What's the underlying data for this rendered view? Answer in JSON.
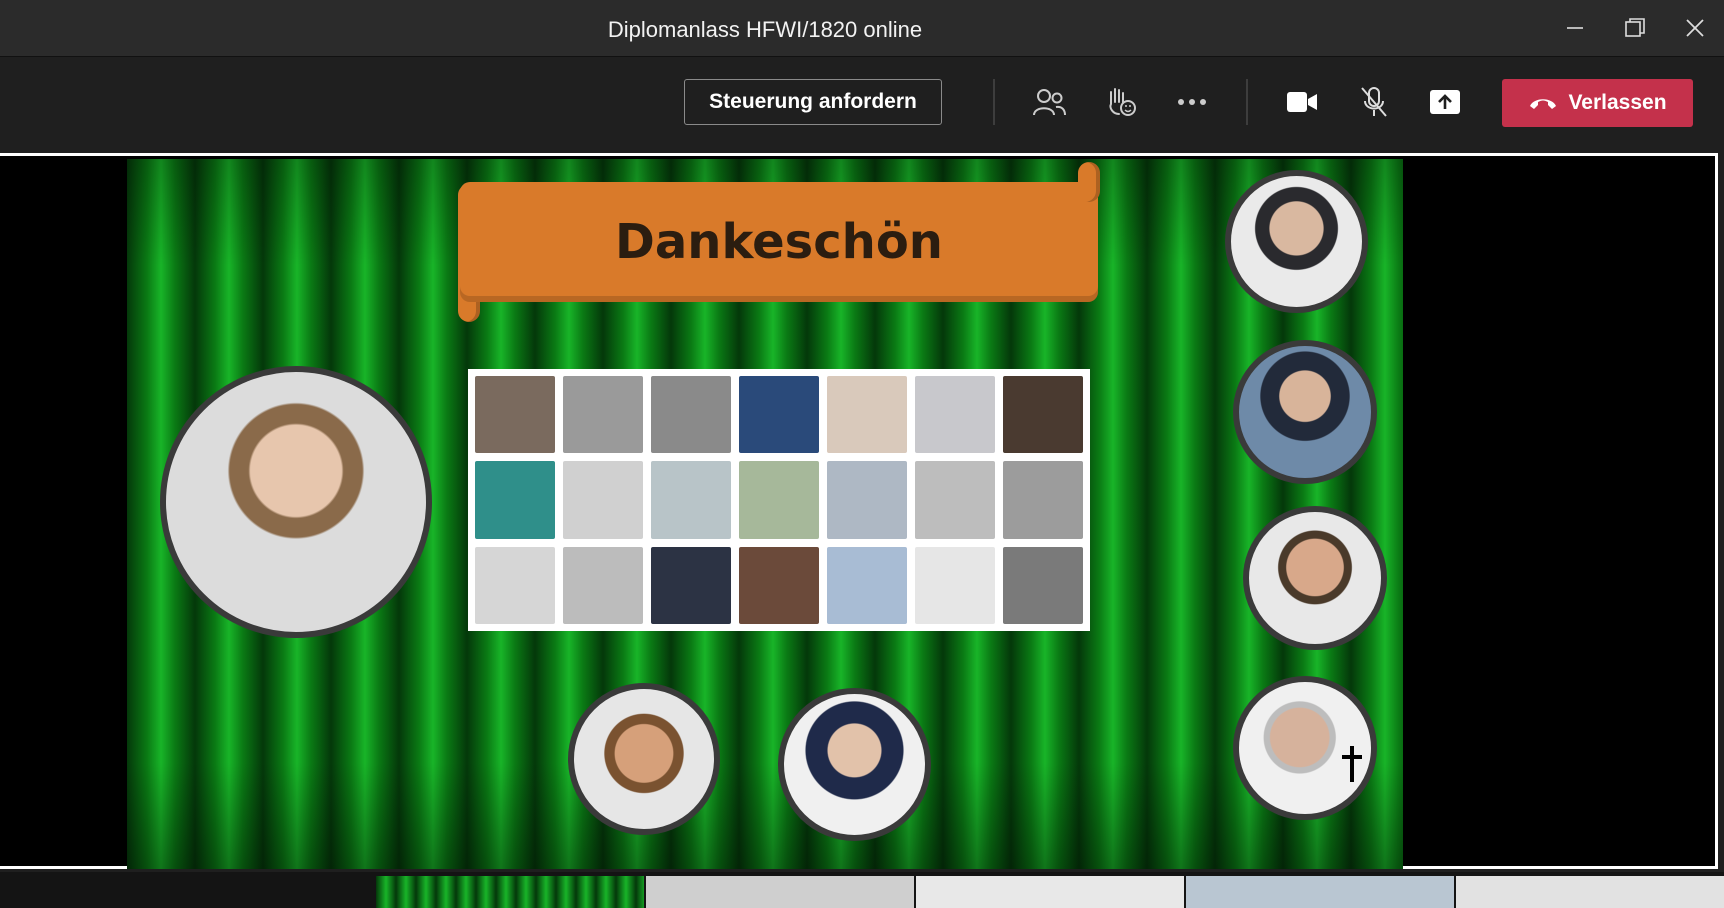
{
  "window": {
    "title": "Diplomanlass HFWI/1820 online"
  },
  "toolbar": {
    "request_control_label": "Steuerung anfordern",
    "leave_label": "Verlassen",
    "icons": [
      "people-icon",
      "raise-hand-icon",
      "more-options-icon",
      "camera-icon",
      "mic-off-icon",
      "share-screen-icon"
    ]
  },
  "slide": {
    "banner_text": "Dankeschön"
  },
  "colors": {
    "leave": "#c4314b",
    "banner": "#d97a2a",
    "curtain": "#18b428"
  }
}
